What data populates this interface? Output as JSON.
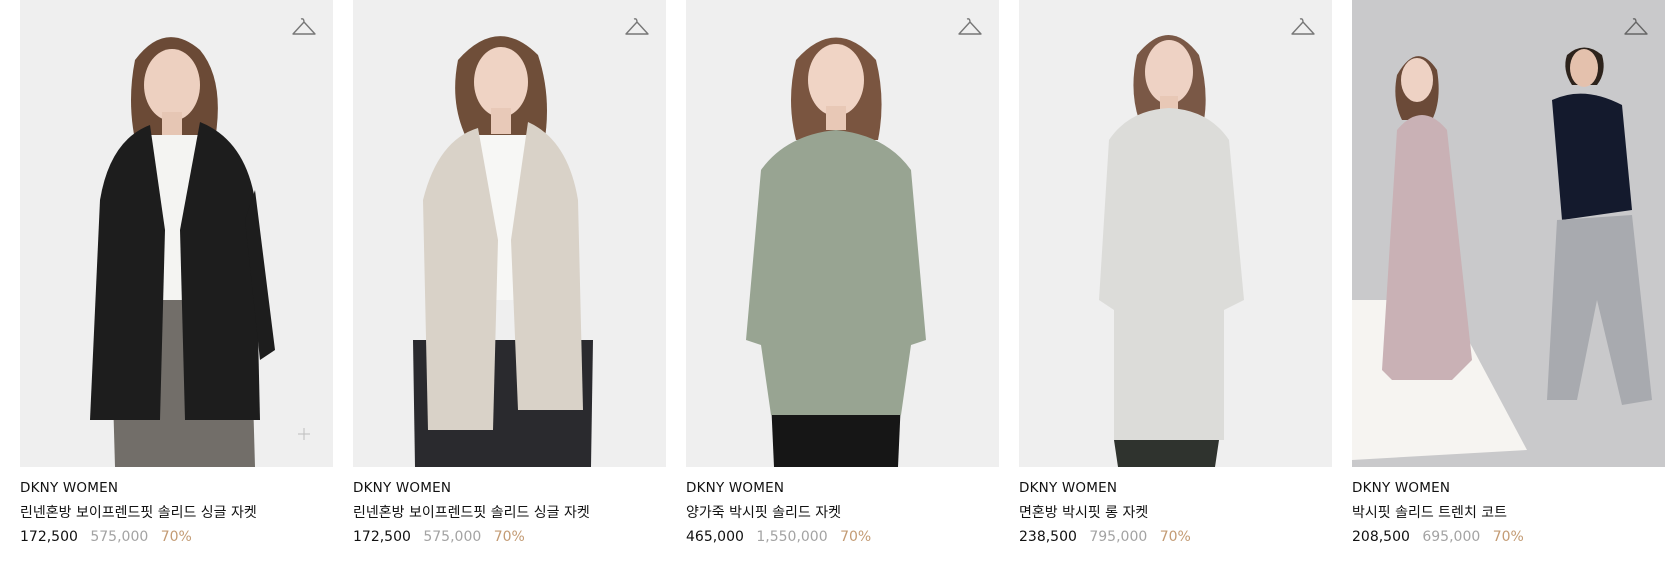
{
  "products": [
    {
      "brand": "DKNY WOMEN",
      "name": "린넨혼방 보이프렌드핏 솔리드 싱글 자켓",
      "sale_price": "172,500",
      "original_price": "575,000",
      "discount": "70%",
      "image_alt": "black linen boyfriend jacket",
      "bg_color": "#efefef",
      "garment_color": "#1d1d1d"
    },
    {
      "brand": "DKNY WOMEN",
      "name": "린넨혼방 보이프렌드핏 솔리드 싱글 자켓",
      "sale_price": "172,500",
      "original_price": "575,000",
      "discount": "70%",
      "image_alt": "beige linen boyfriend jacket",
      "bg_color": "#efefef",
      "garment_color": "#d9d2c8"
    },
    {
      "brand": "DKNY WOMEN",
      "name": "양가죽 박시핏 솔리드 자켓",
      "sale_price": "465,000",
      "original_price": "1,550,000",
      "discount": "70%",
      "image_alt": "sage green leather jacket",
      "bg_color": "#efefef",
      "garment_color": "#98a492"
    },
    {
      "brand": "DKNY WOMEN",
      "name": "면혼방 박시핏 롱 자켓",
      "sale_price": "238,500",
      "original_price": "795,000",
      "discount": "70%",
      "image_alt": "light grey long jacket",
      "bg_color": "#efefef",
      "garment_color": "#dcdcd9"
    },
    {
      "brand": "DKNY WOMEN",
      "name": "박시핏 솔리드 트렌치 코트",
      "sale_price": "208,500",
      "original_price": "695,000",
      "discount": "70%",
      "image_alt": "pink trench coat with male model",
      "bg_color": "#c9c9cb",
      "garment_color": "#c9b1b5"
    }
  ],
  "icons": {
    "wishlist": "hanger-icon",
    "quick_add": "plus-icon"
  },
  "colors": {
    "discount": "#c39b74",
    "original_price": "#a3a3a3",
    "text": "#111111"
  }
}
